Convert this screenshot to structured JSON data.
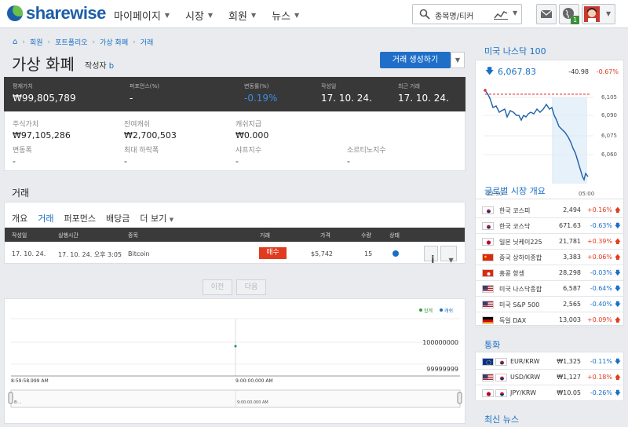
{
  "header": {
    "logo_text": "sharewise",
    "nav": [
      {
        "label": "마이페이지"
      },
      {
        "label": "시장"
      },
      {
        "label": "회원"
      },
      {
        "label": "뉴스"
      }
    ],
    "search_placeholder": "종목명/티커",
    "notification_count": "1"
  },
  "breadcrumb": [
    "회원",
    "포트폴리오",
    "가상 화폐",
    "거래"
  ],
  "page": {
    "title": "가상 화폐",
    "author_label": "작성자",
    "author_name": "b",
    "create_button": "거래 생성하기"
  },
  "stats": [
    {
      "label": "평재가치",
      "value": "₩99,805,789",
      "negative": false
    },
    {
      "label": "퍼포먼스(%)",
      "value": "-",
      "negative": false
    },
    {
      "label": "변동률(%)",
      "value": "-0.19%",
      "negative": true
    },
    {
      "label": "작성일",
      "value": "17. 10. 24.",
      "negative": false
    },
    {
      "label": "최근 거래",
      "value": "17. 10. 24.",
      "negative": false
    }
  ],
  "info": {
    "row1": [
      {
        "label": "주식가치",
        "value": "₩97,105,286"
      },
      {
        "label": "잔여캐쉬",
        "value": "₩2,700,503"
      },
      {
        "label": "캐쉬지급",
        "value": "₩0.000"
      }
    ],
    "row2": [
      {
        "label": "변동폭",
        "value": "-"
      },
      {
        "label": "최대 하락폭",
        "value": "-"
      },
      {
        "label": "샤프지수",
        "value": "-"
      },
      {
        "label": "소르티노지수",
        "value": "-"
      }
    ]
  },
  "trades_section": {
    "title": "거래",
    "tabs": [
      "개요",
      "거래",
      "퍼포먼스",
      "배당금",
      "더 보기"
    ],
    "active_tab": 1,
    "columns": [
      "작성일",
      "실행시간",
      "종목",
      "거래",
      "가격",
      "수량",
      "상태"
    ],
    "rows": [
      {
        "date": "17. 10. 24.",
        "exec_time": "17. 10. 24. 오후 3:05",
        "asset": "Bitcoin",
        "action": "매수",
        "price": "$5,742",
        "qty": "15"
      }
    ],
    "prev_button": "이전",
    "next_button": "다음"
  },
  "bottom_chart": {
    "legend": [
      "합계",
      "캐쉬"
    ],
    "legend_colors": [
      "#3a9a3a",
      "#1a6fc4"
    ],
    "y_labels": [
      "100000000",
      "99999999"
    ],
    "x_labels": [
      "8:59:58.999 AM",
      "9:00:00.000 AM"
    ],
    "nav_labels": [
      "8:...",
      "9:00:00.000 AM"
    ]
  },
  "nasdaq": {
    "title": "미국 나스닥 100",
    "value": "6,067.83",
    "change": "-40.98",
    "change_pct": "-0.67%",
    "y_ticks": [
      "6,105",
      "6,090",
      "6,075",
      "6,060"
    ],
    "x_ticks": [
      "22:30",
      "05:00"
    ]
  },
  "markets": {
    "title": "글로벌 시장 개요",
    "rows": [
      {
        "name": "한국 코스피",
        "value": "2,494",
        "change": "+0.16%",
        "dir": "up",
        "flag": "kr"
      },
      {
        "name": "한국 코스닥",
        "value": "671.63",
        "change": "-0.63%",
        "dir": "dn",
        "flag": "kr"
      },
      {
        "name": "일본 닛케이225",
        "value": "21,781",
        "change": "+0.39%",
        "dir": "up",
        "flag": "jp"
      },
      {
        "name": "중국 상하이종합",
        "value": "3,383",
        "change": "+0.06%",
        "dir": "up",
        "flag": "cn"
      },
      {
        "name": "홍콩 항셍",
        "value": "28,298",
        "change": "-0.03%",
        "dir": "dn",
        "flag": "hk"
      },
      {
        "name": "미국 나스닥종합",
        "value": "6,587",
        "change": "-0.64%",
        "dir": "dn",
        "flag": "us"
      },
      {
        "name": "미국 S&P 500",
        "value": "2,565",
        "change": "-0.40%",
        "dir": "dn",
        "flag": "us"
      },
      {
        "name": "독일 DAX",
        "value": "13,003",
        "change": "+0.09%",
        "dir": "up",
        "flag": "de"
      }
    ]
  },
  "currency": {
    "title": "통화",
    "rows": [
      {
        "name": "EUR/KRW",
        "value": "₩1,325",
        "change": "-0.11%",
        "dir": "dn",
        "flag1": "eu",
        "flag2": "kr"
      },
      {
        "name": "USD/KRW",
        "value": "₩1,127",
        "change": "+0.18%",
        "dir": "up",
        "flag1": "us",
        "flag2": "kr"
      },
      {
        "name": "JPY/KRW",
        "value": "₩10.05",
        "change": "-0.26%",
        "dir": "dn",
        "flag1": "jp",
        "flag2": "kr"
      }
    ]
  },
  "latest_news": {
    "title": "최신 뉴스"
  }
}
